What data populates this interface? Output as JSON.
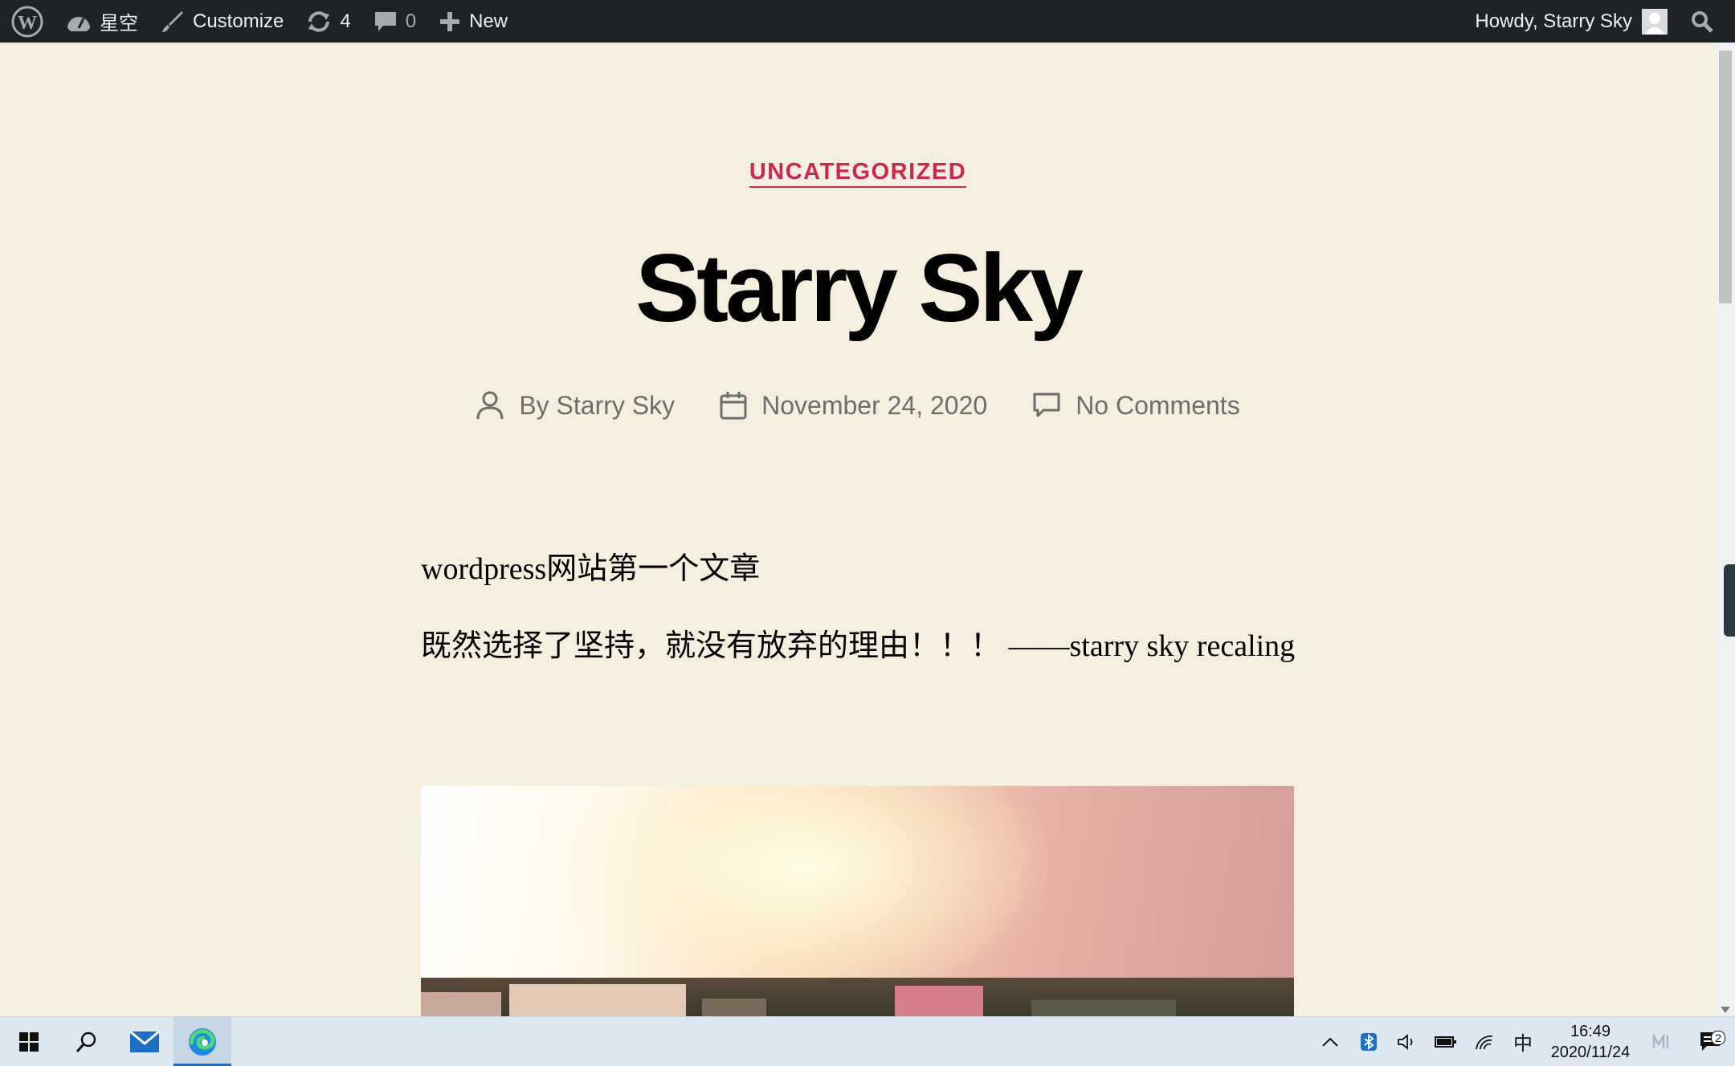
{
  "adminbar": {
    "site_name": "星空",
    "customize_label": "Customize",
    "updates_count": "4",
    "comments_count": "0",
    "new_label": "New",
    "greeting": "Howdy, Starry Sky"
  },
  "post": {
    "category": "UNCATEGORIZED",
    "title": "Starry Sky",
    "author": "By Starry Sky",
    "date": "November 24, 2020",
    "comments": "No Comments",
    "paragraphs": [
      "wordpress网站第一个文章",
      "既然选择了坚持，就没有放弃的理由！！！ ——starry sky recaling"
    ]
  },
  "taskbar": {
    "ime": "中",
    "time": "16:49",
    "date": "2020/11/24",
    "notification_count": "2"
  },
  "colors": {
    "accent": "#cd2653",
    "background": "#f5efe0",
    "adminbar": "#1d2327"
  },
  "icons": [
    "wordpress-icon",
    "dashboard-icon",
    "brush-icon",
    "refresh-icon",
    "comment-icon",
    "plus-icon",
    "avatar",
    "search-icon",
    "person-icon",
    "calendar-icon",
    "speech-bubble-icon",
    "windows-icon",
    "search-icon",
    "mail-icon",
    "edge-icon"
  ]
}
